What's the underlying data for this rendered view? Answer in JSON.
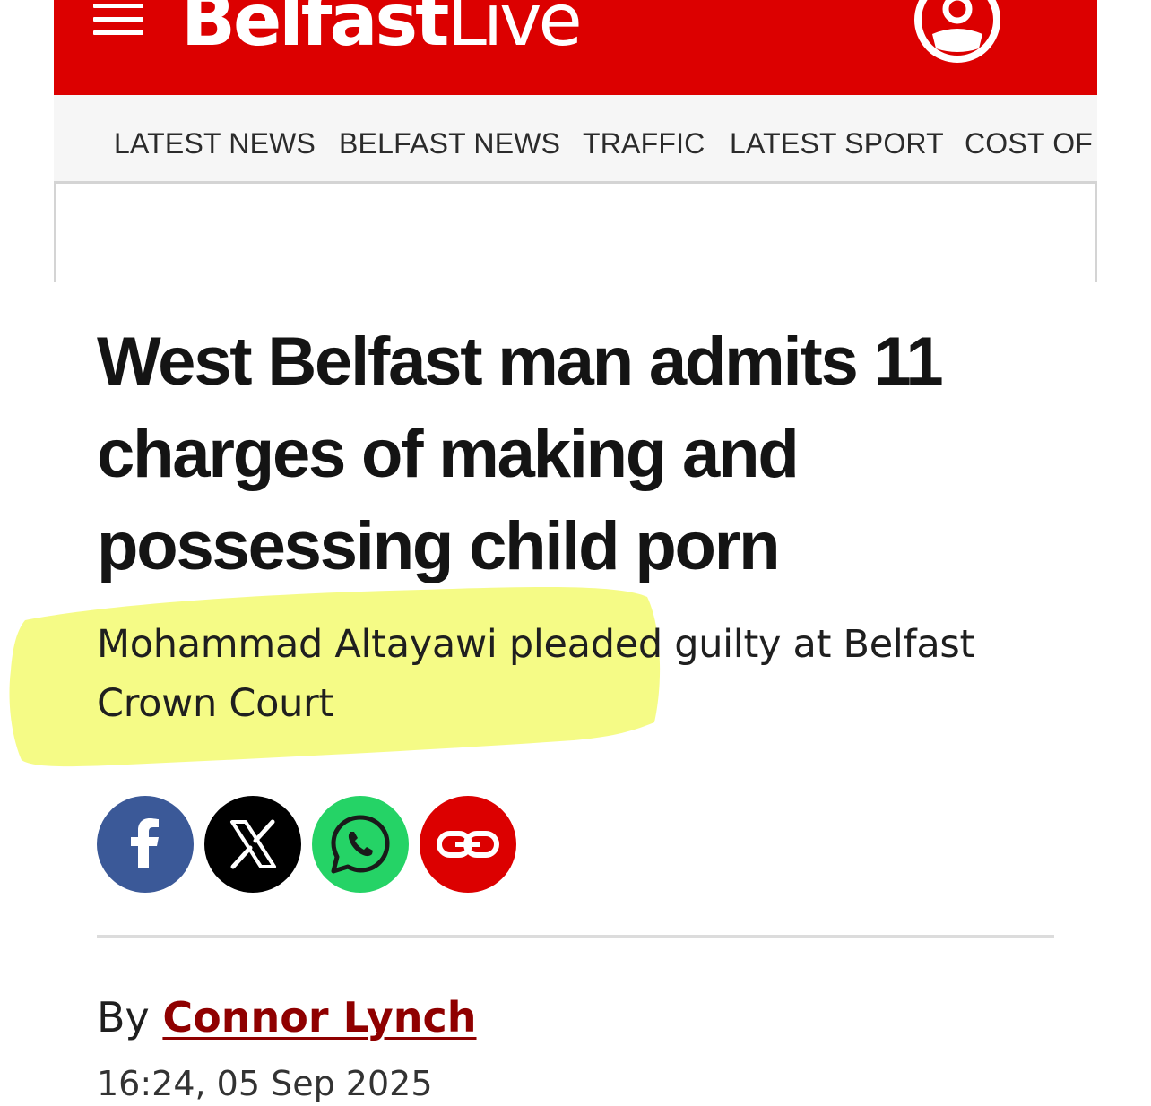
{
  "header": {
    "brand_bold": "Belfast",
    "brand_light": "Live",
    "menu_icon": "hamburger-menu-icon",
    "account_icon": "user-account-icon",
    "background_color": "#dc0000"
  },
  "nav": {
    "items": [
      {
        "label": "LATEST NEWS"
      },
      {
        "label": "BELFAST NEWS"
      },
      {
        "label": "TRAFFIC"
      },
      {
        "label": "LATEST SPORT"
      },
      {
        "label": "COST OF L"
      }
    ]
  },
  "article": {
    "headline": "West Belfast man admits 11 charges of making and possessing child porn",
    "standfirst": "Mohammad Altayawi pleaded guilty at Belfast Crown Court",
    "highlight_color": "#f4fb7c",
    "share": {
      "facebook_icon": "facebook-icon",
      "x_icon": "x-icon",
      "whatsapp_icon": "whatsapp-icon",
      "link_icon": "link-icon",
      "colors": {
        "facebook": "#3b5998",
        "x": "#000000",
        "whatsapp": "#25d366",
        "link": "#dc0000"
      }
    },
    "byline_prefix": "By",
    "author": "Connor Lynch",
    "author_color": "#8f0000",
    "published": "16:24, 05 Sep 2025"
  }
}
